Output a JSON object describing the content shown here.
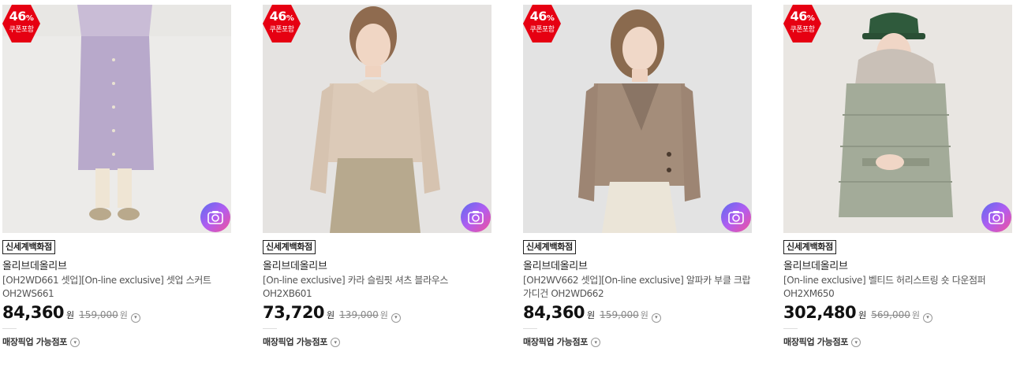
{
  "products": [
    {
      "discount": "46",
      "discount_unit": "%",
      "coupon_label": "쿠폰포함",
      "store": "신세계백화점",
      "brand": "올리브데올리브",
      "title": "[OH2WD661 셋업][On-line exclusive] 셋업 스커트 OH2WS661",
      "price": "84,360",
      "price_unit": "원",
      "original_price": "159,000",
      "original_unit": "원",
      "pickup_label": "매장픽업 가능점포",
      "image_icon": "lavender-knit-skirt-photo",
      "bg": "#ecebea"
    },
    {
      "discount": "46",
      "discount_unit": "%",
      "coupon_label": "쿠폰포함",
      "store": "신세계백화점",
      "brand": "올리브데올리브",
      "title": "[On-line exclusive] 카라 슬림핏 셔츠 블라우스 OH2XB601",
      "price": "73,720",
      "price_unit": "원",
      "original_price": "139,000",
      "original_unit": "원",
      "pickup_label": "매장픽업 가능점포",
      "image_icon": "beige-shirt-photo",
      "bg": "#e4e2e0"
    },
    {
      "discount": "46",
      "discount_unit": "%",
      "coupon_label": "쿠폰포함",
      "store": "신세계백화점",
      "brand": "올리브데올리브",
      "title": "[OH2WV662 셋업][On-line exclusive] 알파카 부클 크랍 가디건 OH2WD662",
      "price": "84,360",
      "price_unit": "원",
      "original_price": "159,000",
      "original_unit": "원",
      "pickup_label": "매장픽업 가능점포",
      "image_icon": "taupe-cardigan-photo",
      "bg": "#e3e3e3"
    },
    {
      "discount": "46",
      "discount_unit": "%",
      "coupon_label": "쿠폰포함",
      "store": "신세계백화점",
      "brand": "올리브데올리브",
      "title": "[On-line exclusive] 벨티드 허리스트링 숏 다운점퍼 OH2XM650",
      "price": "302,480",
      "price_unit": "원",
      "original_price": "569,000",
      "original_unit": "원",
      "pickup_label": "매장픽업 가능점포",
      "image_icon": "sage-down-jacket-photo",
      "bg": "#e9e6e2"
    }
  ]
}
